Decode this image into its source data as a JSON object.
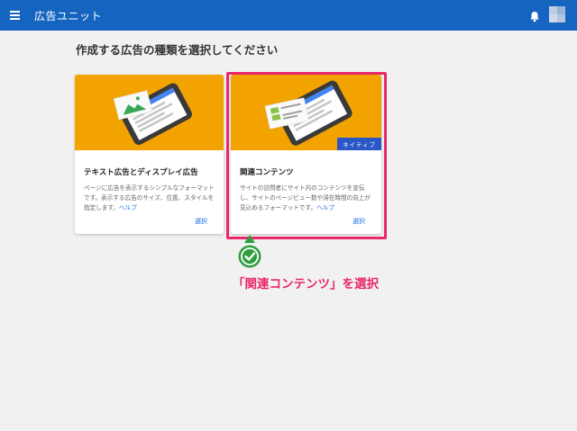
{
  "topbar": {
    "app_title": "広告ユニット",
    "menu_icon": "hamburger-menu-icon",
    "notification_icon": "bell-icon",
    "avatar_icon": "avatar-icon"
  },
  "main": {
    "heading": "作成する広告の種類を選択してください",
    "cards": [
      {
        "title": "テキスト広告とディスプレイ広告",
        "description": "ページに広告を表示するシンプルなフォーマットです。表示する広告のサイズ、位置、スタイルを指定します。",
        "help_link": "ヘルプ",
        "select_label": "選択",
        "illustration_icon": "phone-display-ad-icon"
      },
      {
        "title": "関連コンテンツ",
        "badge": "ネイティブ",
        "description": "サイトの訪問者にサイト内のコンテンツを宣伝し、サイトのページビュー数や滞在時間の向上が見込めるフォーマットです。",
        "help_link": "ヘルプ",
        "select_label": "選択",
        "illustration_icon": "phone-native-content-icon"
      }
    ]
  },
  "annotation": {
    "callout": "「関連コンテンツ」を選択",
    "marker_icon": "check-pin-icon",
    "highlight_color": "#e8276c",
    "marker_color": "#2e9e3f"
  },
  "colors": {
    "topbar": "#1565c0",
    "hero": "#f2a300",
    "link": "#1a73e8",
    "badge": "#2a56c6"
  }
}
